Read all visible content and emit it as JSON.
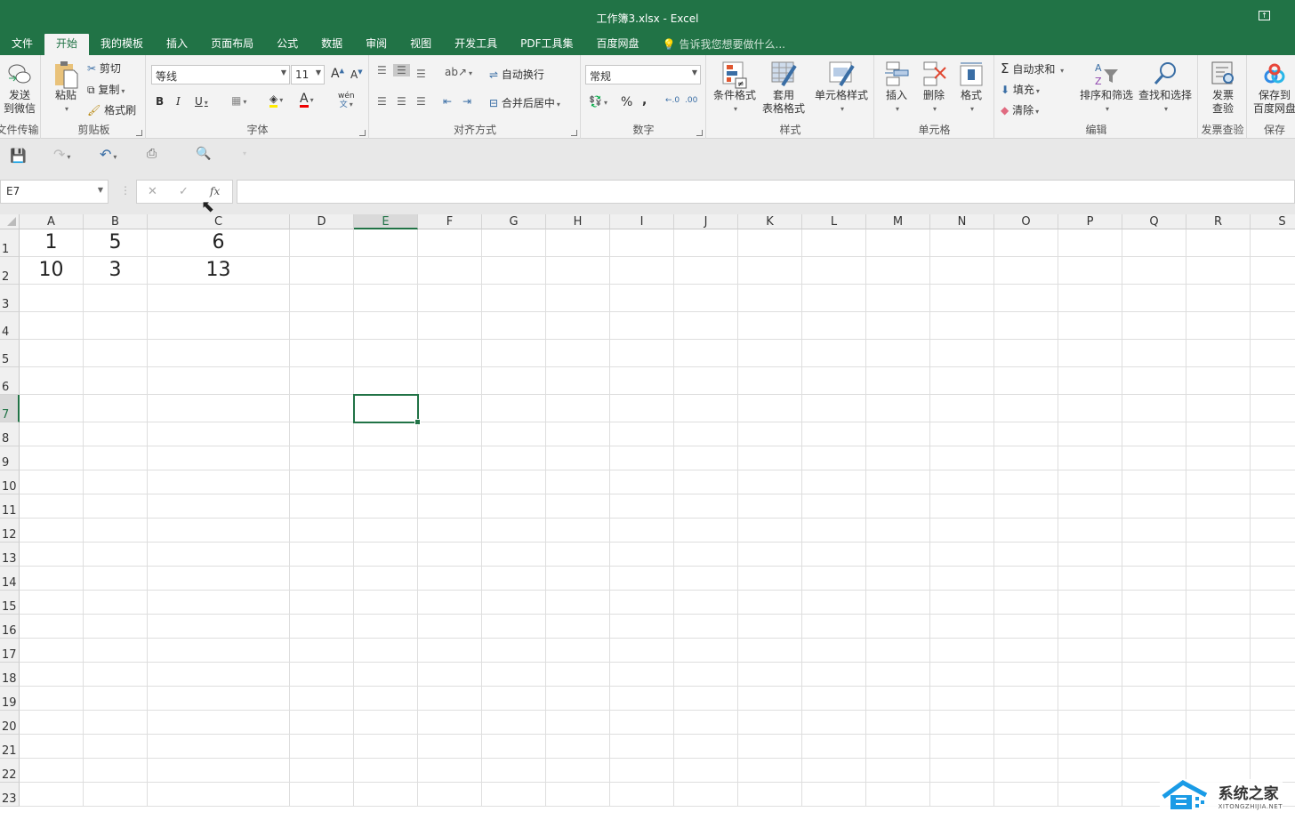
{
  "window": {
    "title": "工作簿3.xlsx - Excel"
  },
  "tabs": [
    "文件",
    "开始",
    "我的模板",
    "插入",
    "页面布局",
    "公式",
    "数据",
    "审阅",
    "视图",
    "开发工具",
    "PDF工具集",
    "百度网盘"
  ],
  "active_tab": "开始",
  "tell_me": "告诉我您想要做什么...",
  "ribbon": {
    "file_transfer": {
      "button": "发送\n到微信",
      "label": "文件传输"
    },
    "clipboard": {
      "paste": "粘贴",
      "cut": "剪切",
      "copy": "复制",
      "format_painter": "格式刷",
      "label": "剪贴板"
    },
    "font": {
      "font_name": "等线",
      "font_size": "11",
      "bold": "B",
      "italic": "I",
      "underline": "U",
      "label": "字体",
      "phonetic": "wén"
    },
    "alignment": {
      "wrap_text": "自动换行",
      "merge_center": "合并后居中",
      "label": "对齐方式"
    },
    "number": {
      "format": "常规",
      "percent": "%",
      "comma": ",",
      "label": "数字"
    },
    "styles": {
      "conditional": "条件格式",
      "table_format": "套用\n表格格式",
      "cell_styles": "单元格样式",
      "label": "样式"
    },
    "cells": {
      "insert": "插入",
      "delete": "删除",
      "format": "格式",
      "label": "单元格"
    },
    "editing": {
      "autosum": "自动求和",
      "fill": "填充",
      "clear": "清除",
      "sort_filter": "排序和筛选",
      "find_select": "查找和选择",
      "label": "编辑"
    },
    "invoice": {
      "button": "发票\n查验",
      "label": "发票查验"
    },
    "save": {
      "button": "保存到\n百度网盘",
      "label": "保存"
    }
  },
  "formula_bar": {
    "name_box": "E7",
    "formula": "",
    "fx": "fx"
  },
  "sheet": {
    "columns": [
      "A",
      "B",
      "C",
      "D",
      "E",
      "F",
      "G",
      "H",
      "I",
      "J",
      "K",
      "L",
      "M",
      "N",
      "O",
      "P",
      "Q",
      "R",
      "S"
    ],
    "rows": [
      "1",
      "2",
      "3",
      "4",
      "5",
      "6",
      "7",
      "8",
      "9",
      "10",
      "11",
      "12",
      "13",
      "14",
      "15",
      "16",
      "17",
      "18",
      "19",
      "20",
      "21",
      "22",
      "23"
    ],
    "cells": [
      [
        "1",
        "5",
        "6"
      ],
      [
        "10",
        "3",
        "13"
      ]
    ],
    "selected": {
      "col": "E",
      "row": "7"
    }
  },
  "watermark": {
    "cn": "系统之家",
    "en": "XITONGZHIJIA.NET"
  },
  "colors": {
    "brand": "#217346"
  }
}
